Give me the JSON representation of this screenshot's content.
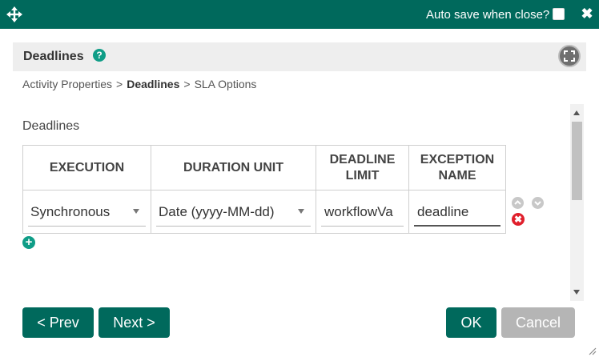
{
  "titlebar": {
    "autosave_label": "Auto save when close?",
    "close_symbol": "✖"
  },
  "section": {
    "title": "Deadlines",
    "help_symbol": "?"
  },
  "breadcrumb": {
    "items": [
      "Activity Properties",
      "Deadlines",
      "SLA Options"
    ],
    "separator": ">"
  },
  "deadlines": {
    "label": "Deadlines",
    "columns": [
      "EXECUTION",
      "DURATION UNIT",
      "DEADLINE LIMIT",
      "EXCEPTION NAME"
    ],
    "rows": [
      {
        "execution": "Synchronous",
        "duration_unit": "Date (yyyy-MM-dd)",
        "deadline_limit": "workflowVa",
        "exception_name": "deadline"
      }
    ],
    "delete_symbol": "✖",
    "add_symbol": "+"
  },
  "buttons": {
    "prev": "< Prev",
    "next": "Next >",
    "ok": "OK",
    "cancel": "Cancel"
  },
  "colors": {
    "primary": "#00695c",
    "accent": "#0f9d87",
    "danger": "#e0202c",
    "disabled": "#b5b5b5"
  },
  "icons": [
    "move-icon",
    "checkbox",
    "close-icon",
    "help-icon",
    "expand-icon",
    "move-up-icon",
    "move-down-icon",
    "delete-icon",
    "add-icon",
    "resize-grip-icon"
  ]
}
